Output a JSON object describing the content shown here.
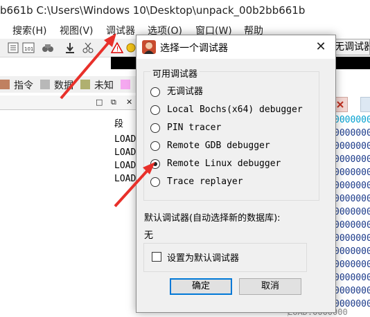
{
  "window": {
    "title": "b661b C:\\Users\\Windows 10\\Desktop\\unpack_00b2bb661b"
  },
  "menu": [
    "搜索(H)",
    "视图(V)",
    "调试器",
    "选项(O)",
    "窗口(W)",
    "帮助"
  ],
  "toolbar_right_button": "无调试器",
  "legend": [
    {
      "label": "指令",
      "color": "#c08060"
    },
    {
      "label": "数据",
      "color": "#b8b8b8"
    },
    {
      "label": "未知",
      "color": "#b0b070"
    },
    {
      "label": "",
      "color": "#f5a8f0"
    }
  ],
  "pane_controls": [
    "□",
    "⧉",
    "✕"
  ],
  "segment_column": {
    "header": "段",
    "rows": [
      "LOAD",
      "LOAD",
      "LOAD",
      "LOAD"
    ]
  },
  "hex_rows": [
    "0000000",
    "0000000",
    "0000000",
    "0000000",
    "0000000",
    "0000000",
    "0000000",
    "0000000",
    "0000000",
    "0000000",
    "0000000",
    "0000000",
    "0000000",
    "0000000",
    "0000000"
  ],
  "hex_tail": "LOAD:0000000",
  "dialog": {
    "title": "选择一个调试器",
    "group_label": "可用调试器",
    "options": [
      {
        "label": "无调试器",
        "selected": false
      },
      {
        "label": "Local Bochs(x64) debugger",
        "selected": false
      },
      {
        "label": "PIN tracer",
        "selected": false
      },
      {
        "label": "Remote GDB debugger",
        "selected": false
      },
      {
        "label": "Remote Linux debugger",
        "selected": true
      },
      {
        "label": "Trace replayer",
        "selected": false
      }
    ],
    "default_label": "默认调试器(自动选择新的数据库):",
    "default_value": "无",
    "set_default_label": "设置为默认调试器",
    "set_default_checked": false,
    "ok_label": "确定",
    "cancel_label": "取消"
  },
  "colors": {
    "annotation_arrow": "#e8302a",
    "ok_border": "#0078d7"
  }
}
